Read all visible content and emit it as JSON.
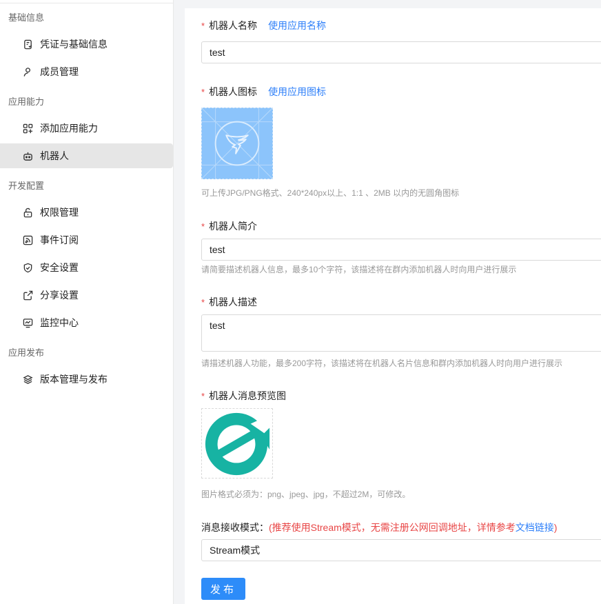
{
  "sidebar": {
    "groups": [
      {
        "title": "基础信息"
      },
      {
        "title": "应用能力"
      },
      {
        "title": "开发配置"
      },
      {
        "title": "应用发布"
      }
    ],
    "items": [
      {
        "label": "凭证与基础信息",
        "icon": "credential-icon"
      },
      {
        "label": "成员管理",
        "icon": "person-icon"
      },
      {
        "label": "添加应用能力",
        "icon": "grid-plus-icon"
      },
      {
        "label": "机器人",
        "icon": "robot-icon",
        "active": true
      },
      {
        "label": "权限管理",
        "icon": "lock-open-icon"
      },
      {
        "label": "事件订阅",
        "icon": "rss-icon"
      },
      {
        "label": "安全设置",
        "icon": "shield-icon"
      },
      {
        "label": "分享设置",
        "icon": "share-icon"
      },
      {
        "label": "监控中心",
        "icon": "monitor-icon"
      },
      {
        "label": "版本管理与发布",
        "icon": "layers-icon"
      }
    ]
  },
  "form": {
    "required_mark": "*",
    "name": {
      "label": "机器人名称",
      "link": "使用应用名称",
      "value": "test"
    },
    "icon": {
      "label": "机器人图标",
      "link": "使用应用图标",
      "hint": "可上传JPG/PNG格式、240*240px以上、1:1 、2MB 以内的无圆角图标"
    },
    "intro": {
      "label": "机器人简介",
      "value": "test",
      "hint": "请简要描述机器人信息，最多10个字符，该描述将在群内添加机器人时向用户进行展示"
    },
    "desc": {
      "label": "机器人描述",
      "value": "test",
      "hint": "请描述机器人功能，最多200字符，该描述将在机器人名片信息和群内添加机器人时向用户进行展示"
    },
    "preview": {
      "label": "机器人消息预览图",
      "hint": "图片格式必须为：png、jpeg、jpg，不超过2M，可修改。"
    },
    "mode": {
      "label": "消息接收模式：",
      "note_prefix": "(推荐使用Stream模式，无需注册公网回调地址，详情参考",
      "note_link": "文档链接",
      "note_suffix": ")",
      "value": "Stream模式"
    },
    "publish_label": "发布"
  },
  "colors": {
    "accent": "#2d7ff9",
    "required": "#e84545",
    "active_bg": "#e6e6e6",
    "logo_teal": "#17b3a3"
  }
}
